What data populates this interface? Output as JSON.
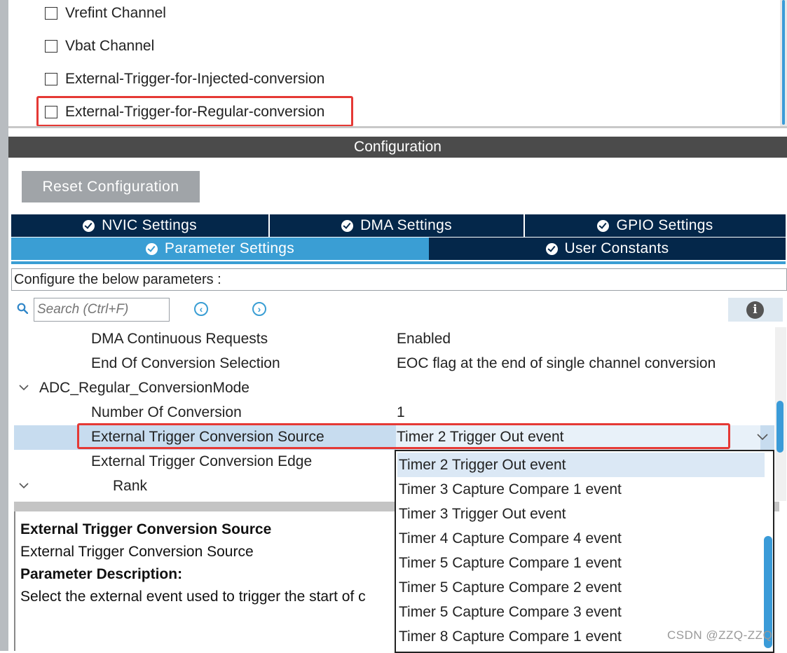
{
  "checkboxes": [
    {
      "label": "Vrefint Channel",
      "checked": false
    },
    {
      "label": "Vbat Channel",
      "checked": false
    },
    {
      "label": "External-Trigger-for-Injected-conversion",
      "checked": false
    },
    {
      "label": "External-Trigger-for-Regular-conversion",
      "checked": false
    }
  ],
  "config_bar": {
    "title": "Configuration"
  },
  "reset_button": {
    "label": "Reset Configuration"
  },
  "tabs": {
    "nvic": "NVIC Settings",
    "dma": "DMA Settings",
    "gpio": "GPIO Settings",
    "parameter": "Parameter Settings",
    "user_constants": "User Constants"
  },
  "configure_label": "Configure the below parameters :",
  "search": {
    "placeholder": "Search (Ctrl+F)"
  },
  "params": [
    {
      "label": "DMA Continuous Requests",
      "value": "Enabled"
    },
    {
      "label": "End Of Conversion Selection",
      "value": "EOC flag at the end of single channel conversion"
    },
    {
      "label": "ADC_Regular_ConversionMode",
      "value": ""
    },
    {
      "label": "Number Of Conversion",
      "value": "1"
    },
    {
      "label": "External Trigger Conversion Source",
      "value": "Timer 2 Trigger Out event"
    },
    {
      "label": "External Trigger Conversion Edge",
      "value": ""
    },
    {
      "label": "Rank",
      "value": ""
    }
  ],
  "dropdown_options": [
    "Timer 2 Trigger Out event",
    "Timer 3 Capture Compare 1 event",
    "Timer 3 Trigger Out event",
    "Timer 4 Capture Compare 4 event",
    "Timer 5 Capture Compare 1 event",
    "Timer 5 Capture Compare 2 event",
    "Timer 5 Capture Compare 3 event",
    "Timer 8 Capture Compare 1 event"
  ],
  "description": {
    "title": "External Trigger Conversion Source",
    "subtitle": "External Trigger Conversion Source",
    "param_heading": "Parameter Description:",
    "text": "Select the external event used to trigger the start of c"
  },
  "watermark": "CSDN @ZZQ-ZZQ",
  "colors": {
    "accent": "#3a9ed4",
    "tab_dark": "#04274a",
    "highlight": "#e53935"
  }
}
